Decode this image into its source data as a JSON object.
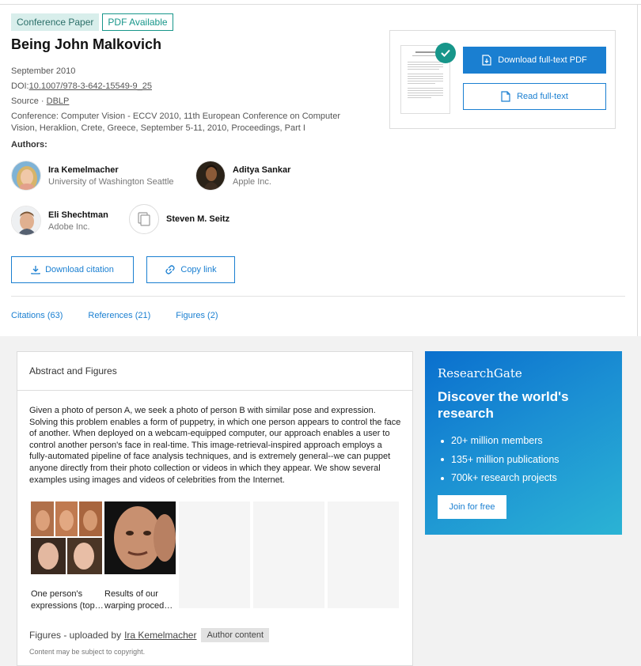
{
  "publication": {
    "type_badge": "Conference Paper",
    "pdf_badge": "PDF Available",
    "title": "Being John Malkovich",
    "date": "September 2010",
    "doi_label": "DOI:",
    "doi": "10.1007/978-3-642-15549-9_25",
    "source_label": "Source · ",
    "source": "DBLP",
    "conference": "Conference: Computer Vision - ECCV 2010, 11th European Conference on Computer Vision, Heraklion, Crete, Greece, September 5-11, 2010, Proceedings, Part I"
  },
  "authors_heading": "Authors:",
  "authors": [
    {
      "name": "Ira Kemelmacher",
      "affiliation": "University of Washington Seattle"
    },
    {
      "name": "Aditya Sankar",
      "affiliation": "Apple Inc."
    },
    {
      "name": "Eli Shechtman",
      "affiliation": "Adobe Inc."
    },
    {
      "name": "Steven M. Seitz",
      "affiliation": ""
    }
  ],
  "actions": {
    "download_citation": "Download citation",
    "copy_link": "Copy link",
    "download_pdf": "Download full-text PDF",
    "read_full_text": "Read full-text"
  },
  "tabs": [
    "Citations (63)",
    "References (21)",
    "Figures (2)"
  ],
  "abstract_card": {
    "heading": "Abstract and Figures",
    "text": "Given a photo of person A, we seek a photo of person B with similar pose and expression. Solving this problem enables a form of puppetry, in which one person appears to control the face of another. When deployed on a webcam-equipped computer, our approach enables a user to control another person's face in real-time. This image-retrieval-inspired approach employs a fully-automated pipeline of face analysis techniques, and is extremely general--we can puppet anyone directly from their photo collection or videos in which they appear. We show several examples using images and videos of celebrities from the Internet.",
    "figures": [
      {
        "caption_line1": "One person's",
        "caption_line2": "expressions (top…"
      },
      {
        "caption_line1": "Results of our",
        "caption_line2": "warping proced…"
      }
    ],
    "uploaded_prefix": "Figures - uploaded by",
    "uploaded_by": "Ira Kemelmacher",
    "author_content_tag": "Author content",
    "copyright": "Content may be subject to copyright."
  },
  "researchgate": {
    "logo": "ResearchGate",
    "headline": "Discover the world's research",
    "stats": [
      "20+ million members",
      "135+ million publications",
      "700k+ research projects"
    ],
    "join_label": "Join for free"
  },
  "colors": {
    "accent_blue": "#1a7fd1",
    "teal": "#17968a",
    "badge_bg": "#d8eeeb"
  }
}
